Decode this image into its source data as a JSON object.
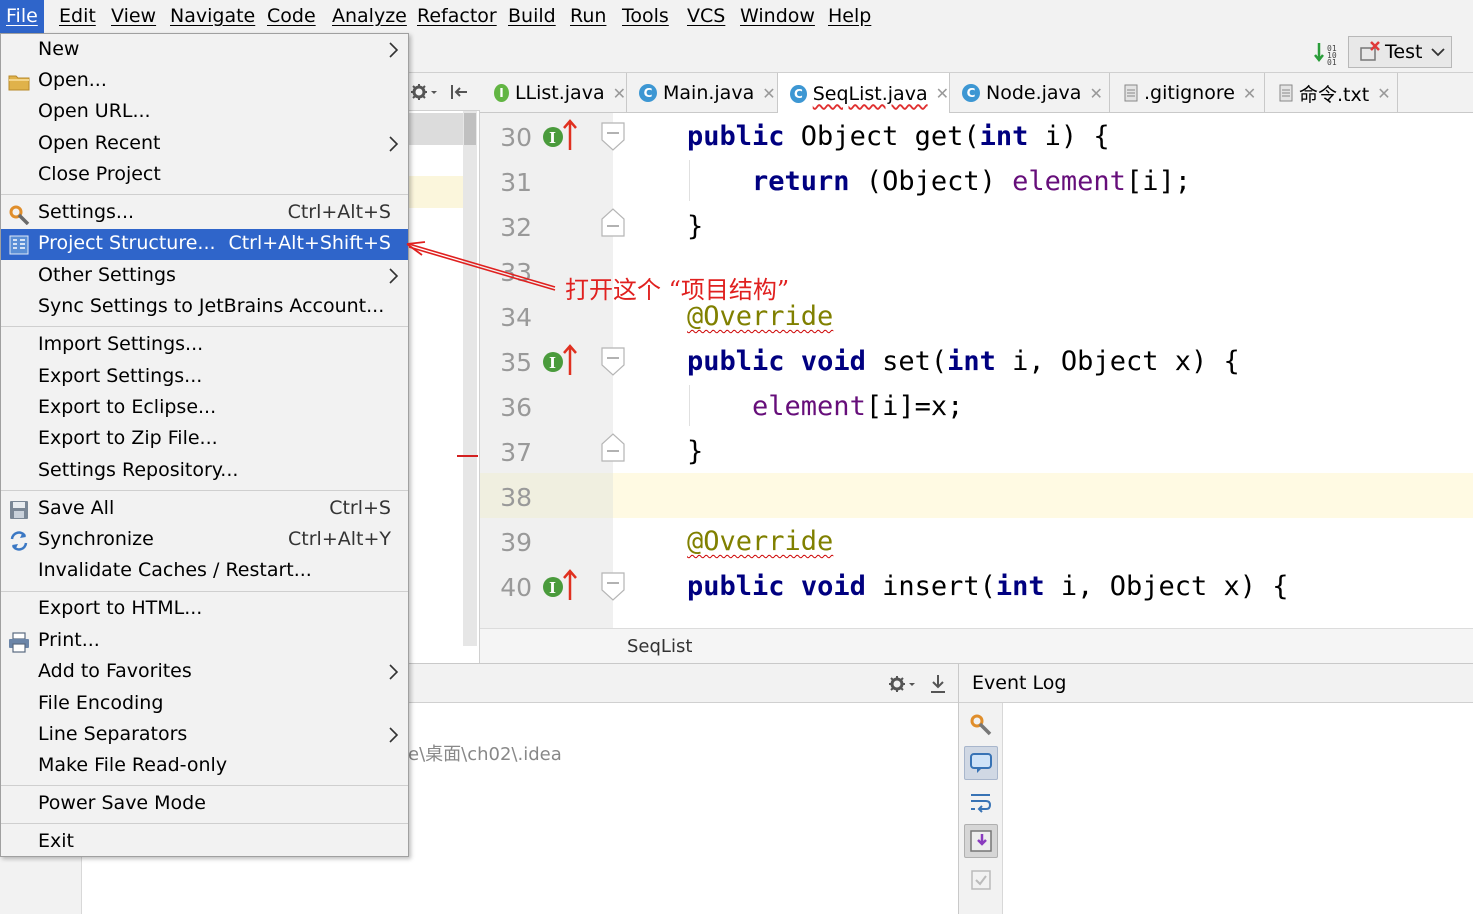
{
  "menubar": {
    "items": [
      "File",
      "Edit",
      "View",
      "Navigate",
      "Code",
      "Analyze",
      "Refactor",
      "Build",
      "Run",
      "Tools",
      "VCS",
      "Window",
      "Help"
    ]
  },
  "toolbar": {
    "run_config": "Test"
  },
  "tabs": [
    {
      "label": "LList.java",
      "icon": "interface-icon",
      "color": "#62b543",
      "letter": "I"
    },
    {
      "label": "Main.java",
      "icon": "class-run-icon",
      "color": "#3d97d3",
      "letter": "C"
    },
    {
      "label": "SeqList.java",
      "icon": "class-icon",
      "color": "#3d97d3",
      "letter": "C"
    },
    {
      "label": "Node.java",
      "icon": "class-icon",
      "color": "#3d97d3",
      "letter": "C"
    },
    {
      "label": ".gitignore",
      "icon": "text-file-icon",
      "color": "#888888",
      "letter": ""
    },
    {
      "label": "命令.txt",
      "icon": "text-file-icon",
      "color": "#888888",
      "letter": ""
    }
  ],
  "editor": {
    "lines": [
      {
        "n": "30",
        "segs": [
          [
            "kw",
            "public"
          ],
          [
            "t",
            " Object get("
          ],
          [
            "kw",
            "int"
          ],
          [
            "t",
            " i) {"
          ]
        ]
      },
      {
        "n": "31",
        "segs": [
          [
            "t",
            "    "
          ],
          [
            "kw",
            "return"
          ],
          [
            "t",
            " (Object) "
          ],
          [
            "fld",
            "element"
          ],
          [
            "t",
            "[i];"
          ]
        ]
      },
      {
        "n": "32",
        "segs": [
          [
            "t",
            "}"
          ]
        ]
      },
      {
        "n": "33",
        "segs": [
          [
            "t",
            ""
          ]
        ]
      },
      {
        "n": "34",
        "segs": [
          [
            "ann",
            "@Override"
          ]
        ]
      },
      {
        "n": "35",
        "segs": [
          [
            "kw",
            "public"
          ],
          [
            "t",
            " "
          ],
          [
            "kw",
            "void"
          ],
          [
            "t",
            " set("
          ],
          [
            "kw",
            "int"
          ],
          [
            "t",
            " i, Object x) {"
          ]
        ]
      },
      {
        "n": "36",
        "segs": [
          [
            "t",
            "    "
          ],
          [
            "fld",
            "element"
          ],
          [
            "t",
            "[i]=x;"
          ]
        ]
      },
      {
        "n": "37",
        "segs": [
          [
            "t",
            "}"
          ]
        ]
      },
      {
        "n": "38",
        "segs": [
          [
            "t",
            ""
          ]
        ]
      },
      {
        "n": "39",
        "segs": [
          [
            "ann",
            "@Override"
          ]
        ]
      },
      {
        "n": "40",
        "segs": [
          [
            "kw",
            "public"
          ],
          [
            "t",
            " "
          ],
          [
            "kw",
            "void"
          ],
          [
            "t",
            " insert("
          ],
          [
            "kw",
            "int"
          ],
          [
            "t",
            " i, Object x) {"
          ]
        ]
      }
    ],
    "breadcrumb": "SeqList"
  },
  "bottom": {
    "path_text": "e\\桌面\\ch02\\.idea",
    "event_log_title": "Event Log"
  },
  "file_menu": {
    "groups": [
      [
        {
          "label": "New",
          "arrow": true
        },
        {
          "label": "Open...",
          "icon": "folder-icon"
        },
        {
          "label": "Open URL..."
        },
        {
          "label": "Open Recent",
          "arrow": true
        },
        {
          "label": "Close Project"
        }
      ],
      [
        {
          "label": "Settings...",
          "shortcut": "Ctrl+Alt+S",
          "icon": "settings-wrench-icon"
        },
        {
          "label": "Project Structure...",
          "shortcut": "Ctrl+Alt+Shift+S",
          "icon": "project-structure-icon",
          "highlighted": true
        },
        {
          "label": "Other Settings",
          "arrow": true
        },
        {
          "label": "Sync Settings to JetBrains Account..."
        }
      ],
      [
        {
          "label": "Import Settings..."
        },
        {
          "label": "Export Settings..."
        },
        {
          "label": "Export to Eclipse..."
        },
        {
          "label": "Export to Zip File..."
        },
        {
          "label": "Settings Repository..."
        }
      ],
      [
        {
          "label": "Save All",
          "shortcut": "Ctrl+S",
          "icon": "save-icon"
        },
        {
          "label": "Synchronize",
          "shortcut": "Ctrl+Alt+Y",
          "icon": "sync-icon"
        },
        {
          "label": "Invalidate Caches / Restart..."
        }
      ],
      [
        {
          "label": "Export to HTML..."
        },
        {
          "label": "Print...",
          "icon": "printer-icon"
        },
        {
          "label": "Add to Favorites",
          "arrow": true
        },
        {
          "label": "File Encoding"
        },
        {
          "label": "Line Separators",
          "arrow": true
        },
        {
          "label": "Make File Read-only"
        }
      ],
      [
        {
          "label": "Power Save Mode"
        }
      ],
      [
        {
          "label": "Exit"
        }
      ]
    ]
  },
  "annotation": {
    "text": "打开这个 “项目结构”",
    "color": "#e0201f"
  }
}
